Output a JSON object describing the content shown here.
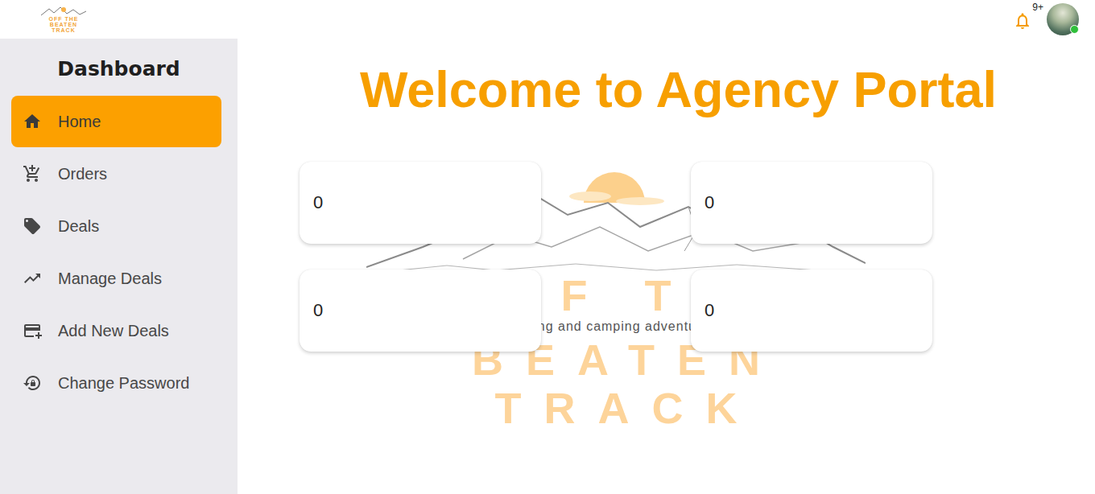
{
  "brand": {
    "lines": [
      "OFF THE",
      "BEATEN",
      "TRACK"
    ],
    "tagline": "hiking and camping adventures"
  },
  "topbar": {
    "notifications": {
      "badge": "9+"
    },
    "user": {
      "online": true
    }
  },
  "sidebar": {
    "title": "Dashboard",
    "items": [
      {
        "label": "Home",
        "selected": true
      },
      {
        "label": "Orders",
        "selected": false
      },
      {
        "label": "Deals",
        "selected": false
      },
      {
        "label": "Manage Deals",
        "selected": false
      },
      {
        "label": "Add New Deals",
        "selected": false
      },
      {
        "label": "Change Password",
        "selected": false
      }
    ]
  },
  "main": {
    "title": "Welcome to Agency Portal"
  },
  "stats": [
    {
      "value": "0"
    },
    {
      "value": "0"
    },
    {
      "value": "0"
    },
    {
      "value": "0"
    }
  ]
}
